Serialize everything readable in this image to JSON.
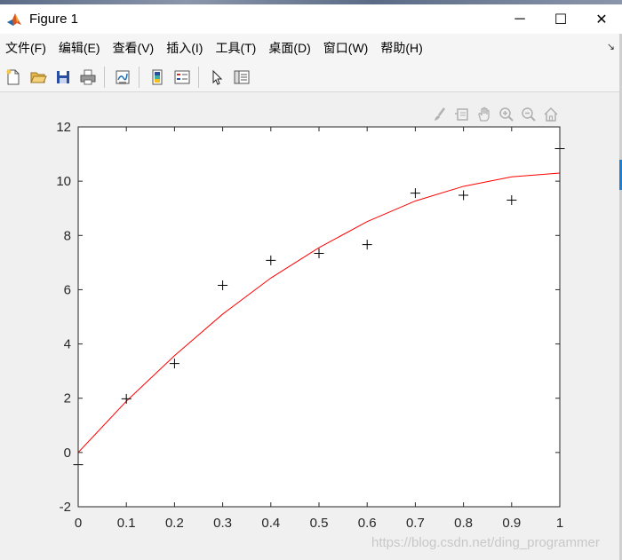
{
  "window": {
    "title": "Figure 1",
    "controls": {
      "minimize": "─",
      "maximize": "☐",
      "close": "✕"
    }
  },
  "menubar": {
    "items": [
      {
        "label": "文件(F)"
      },
      {
        "label": "编辑(E)"
      },
      {
        "label": "查看(V)"
      },
      {
        "label": "插入(I)"
      },
      {
        "label": "工具(T)"
      },
      {
        "label": "桌面(D)"
      },
      {
        "label": "窗口(W)"
      },
      {
        "label": "帮助(H)"
      }
    ],
    "corner_glyph": "↘"
  },
  "toolbar": {
    "icons": [
      "new-figure-icon",
      "open-file-icon",
      "save-icon",
      "print-icon",
      "link-plot-icon",
      "colorbar-icon",
      "legend-icon",
      "select-pointer-icon",
      "property-editor-icon"
    ]
  },
  "axes_toolbar": {
    "icons": [
      "brush-icon",
      "data-tips-icon",
      "pan-icon",
      "zoom-in-icon",
      "zoom-out-icon",
      "home-icon"
    ]
  },
  "watermark": "https://blog.csdn.net/ding_programmer",
  "colors": {
    "fit_line": "#ff0000",
    "markers": "#000000",
    "axes_bg": "#ffffff",
    "figure_bg": "#f0f0f0"
  },
  "chart_data": {
    "type": "scatter",
    "title": "",
    "xlabel": "",
    "ylabel": "",
    "xlim": [
      0,
      1
    ],
    "ylim": [
      -2,
      12
    ],
    "xticks": [
      0,
      0.1,
      0.2,
      0.3,
      0.4,
      0.5,
      0.6,
      0.7,
      0.8,
      0.9,
      1
    ],
    "xtick_labels": [
      "0",
      "0.1",
      "0.2",
      "0.3",
      "0.4",
      "0.5",
      "0.6",
      "0.7",
      "0.8",
      "0.9",
      "1"
    ],
    "yticks": [
      -2,
      0,
      2,
      4,
      6,
      8,
      10,
      12
    ],
    "ytick_labels": [
      "-2",
      "0",
      "2",
      "4",
      "6",
      "8",
      "10",
      "12"
    ],
    "grid": false,
    "series": [
      {
        "kind": "markers",
        "marker": "+",
        "color": "#000000",
        "x": [
          0,
          0.1,
          0.2,
          0.3,
          0.4,
          0.5,
          0.6,
          0.7,
          0.8,
          0.9,
          1
        ],
        "y": [
          -0.45,
          1.98,
          3.28,
          6.16,
          7.08,
          7.34,
          7.66,
          9.56,
          9.48,
          9.3,
          11.2
        ]
      },
      {
        "kind": "line",
        "color": "#ff0000",
        "x": [
          0,
          0.1,
          0.2,
          0.3,
          0.4,
          0.5,
          0.6,
          0.7,
          0.8,
          0.9,
          1
        ],
        "y": [
          0.0,
          1.89,
          3.57,
          5.1,
          6.43,
          7.55,
          8.51,
          9.27,
          9.81,
          10.16,
          10.3
        ]
      }
    ]
  }
}
